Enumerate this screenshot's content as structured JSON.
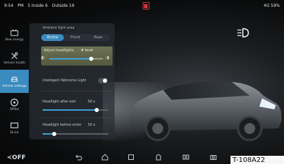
{
  "status_bar": {
    "left_items": [
      "9:54",
      "PM",
      "5 Inside 6",
      "Outside 19"
    ],
    "right": "4G 59%"
  },
  "nav": [
    {
      "label": "New energy",
      "icon": "battery-icon"
    },
    {
      "label": "Vehicle health",
      "icon": "wrench-icon"
    },
    {
      "label": "Vehicle settings",
      "icon": "car-icon",
      "active": true
    },
    {
      "label": "DPilot",
      "icon": "steering-icon"
    },
    {
      "label": "DLink",
      "icon": "screen-icon"
    }
  ],
  "panel": {
    "ambient_title": "Ambient light area",
    "segments": [
      "Entire",
      "Front",
      "Rear"
    ],
    "selected_segment": "Entire",
    "headlights_label": "Adjust headlights",
    "headlights_value": "# level",
    "headlights_level": 0.78,
    "welcome_label": "Intelligent Welcome Light",
    "welcome_on": true,
    "after_exit_label": "Headlight after exit",
    "after_exit_value": "50 s",
    "after_exit_level": 0.82,
    "before_enter_label": "Headlight before enter",
    "before_enter_value": "10 s",
    "before_enter_level": 0.18
  },
  "dock": {
    "off_label": "OFF",
    "icons": [
      "back-icon",
      "home-icon",
      "recent-icon",
      "map-icon",
      "media-icon",
      "camera-icon"
    ]
  },
  "badge": "T-108A22"
}
